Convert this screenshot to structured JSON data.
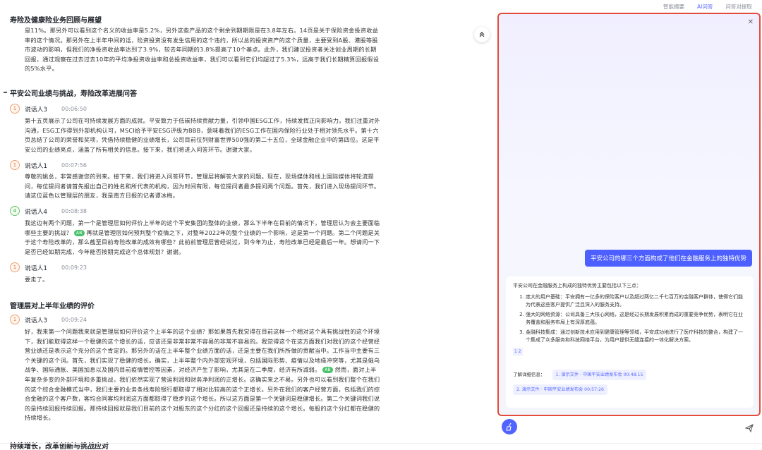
{
  "tabs": {
    "summary": "智能摘要",
    "ai_qa": "AI问答",
    "review": "问答对提取"
  },
  "transcript": {
    "section_title_0": "寿险及健康险业务回顾与展望",
    "para_0": "是11%。那另外可以看到这个名义的收益率是5.2%，另外这些产品的这个剩余到期期限是在3.8年左右。14页是关于保险资金投资收益率的这个情况。那另外在上半年中间的话，险资投资没有发生信用的这个违约，所以总的投资资产的这个质量，主要受到A股、港股等股市波动的影响，但我们的净投资收益率达到了3.9%，较去年同期的3.8%提高了10个基点。此外，我们建议投资者关注创业周期的长期回报，通过观察在过去过去10年的平均净投资收益率和总投资收益率，我们可以看到它们均超过了5.3%，远高于我们长期精算回报假设的5%水平。",
    "section_title_1": "平安公司业绩与挑战，寿险改革进展问答",
    "speaker_1": {
      "avatar": "1",
      "name": "说话人3",
      "time": "00:06:50"
    },
    "para_1": "第十五页展示了公司在可持续发展方面的成就。平安致力于低碳持续贡献力量，引领中国ESG工作，持续发挥正向影响力。我们注重对外沟通，ESG工作得到外部机构认可，MSCI给予平安ESG评级为BBB，意味着我们的ESG工作在国内保险行业处于相对领先水平。第十六页总结了公司的荣誉和奖项，凭借持续稳健的业绩增长，公司目前位列财富世界500强的第二十五位，全球金融企业中的第四位。这是平安公司的业绩亮点，涵盖了所有相关的信息。接下来，我们将进入问答环节。谢谢大家。",
    "speaker_2": {
      "avatar": "1",
      "name": "说话人1",
      "time": "00:07:56"
    },
    "para_2": "尊敬的姚总，非常感谢您的到来。接下来，我们将进入问答环节，管理层将解答大家的问题。现在，现场媒体和线上国际媒体将轮流提问，每位提问者请首先报出自己的姓名和所代表的机构，因为时间有限，每位提问者最多提问两个问题。首先，我们进入现场提问环节。请这位蓝色以管理层的朋友，我是南方日报的记者谭冰梅。",
    "speaker_3": {
      "avatar": "4",
      "name": "说话人4",
      "time": "00:08:38"
    },
    "para_3a": "我这边有两个问题，第一个是管理层如何评价上半年的这个平安集团的整体的业绩，那么下半年在目前的情况下，管理层认为会主要面临哪些主要的挑战？",
    "para_3_tag": "AB",
    "para_3b": "再就是管理层如何预判整个疫情之下，对整年2022年的整个业绩的一个影响，这是第一个问题。第二个问题是关于这个寿险改革的，那么截至目前寿险改革的成效有哪些？此前前管理层曾经说过，到今年为止，寿险改革已经是最后一年。想请问一下是否已经如期完成，今年能否按期完成这个总体规划？谢谢。",
    "speaker_4": {
      "avatar": "1",
      "name": "说话人1",
      "time": "00:09:23"
    },
    "para_4": "要走了。",
    "section_title_2": "管理层对上半年业绩的评价",
    "speaker_5": {
      "avatar": "1",
      "name": "说话人3",
      "time": "00:09:24"
    },
    "para_5a": "好，我来第一个问题我来就是管理层如何评价这个上半年的这个业绩？那如果首先我觉得在目前这样一个相对这个具有挑战性的这个环境下，我们能取得这样一个稳健的这个增长的话，应该还是非常非常不容易的非常不容易的。我觉得这个在这方面我们对我们的这个经营经营业绩还是表示这个充分的这个肯定的。那另外的话在上半年整个业绩方面的话，还是主要在我们所所做的贡献当中。工作当中主要有三个关键的这个词。首先，我们实现了稳健的增长。确实，上半年整个内外部宏观环境，包括国际形势、疫情以及地缘冲突等，尤其是俄乌战争、国际通胀、美国加息以及国内目前疫情管控等因素，对经济产生了影响，尤其是在二季度，经济有所减弱。",
    "para_5_tag": "AB",
    "para_5b": "然而，面对上半年复杂多变的外部环境和多重挑战，我们依然实现了营运利润和财务净利润的正增长。这确实来之不易。另外也可以看到我们整个在我们的这个综合金融模式当中，我们主要的业务条线寿险银行都取得了相对比较高的这个正增长。另外在我们的客户经营方面，包括我们的综合金融的这个客户数，客均合同客均利润这方面都取得了稳步的这个增长。所以这方面是第一个关键词是稳健增长。第二个关键词我们说的是持续回报持续回报。那持续回报就是我们目前的这个对股东的这个分红的这个回报还是持续的这个增长。每股的这个分红都在稳健的持续增长。",
    "section_title_3": "持续增长，改革创新与挑战应对"
  },
  "panel": {
    "question": "平安公司的哪三个方面构成了他们在金融服务上的独特优势",
    "answer_intro": "平安公司在金融服务上构成的独特优势主要包括以下三点：",
    "answer_items": [
      "庞大的用户基础：平安拥有一亿多的保险客户以及超过两亿二千七百万的金融客户群体，使得它们能为代表这些客户提供广泛且深入的服务支持。",
      "强大的网络资源：公司具备三大核心网络，这是经过长期发展积累而成的重要竞争优势，表明它在业务覆盖和服务布局上有深厚底蕴。",
      "金融科技集成：通过创新技术应用到健康管理等领域，平安成功地进行了医疗科技的整合，构建了一个集成了众多服务和科技网络平台，为用户提供无缝连接的一体化解决方案。"
    ],
    "ref_nums": "1 2",
    "more_label": "了解详细信息：",
    "ref_1": "1. 演示文件 · 中国平安业绩发布会 00:48:15",
    "ref_2": "2. 演示文件 · 中国平安业绩发布会 00:57:26",
    "input_placeholder": ""
  }
}
